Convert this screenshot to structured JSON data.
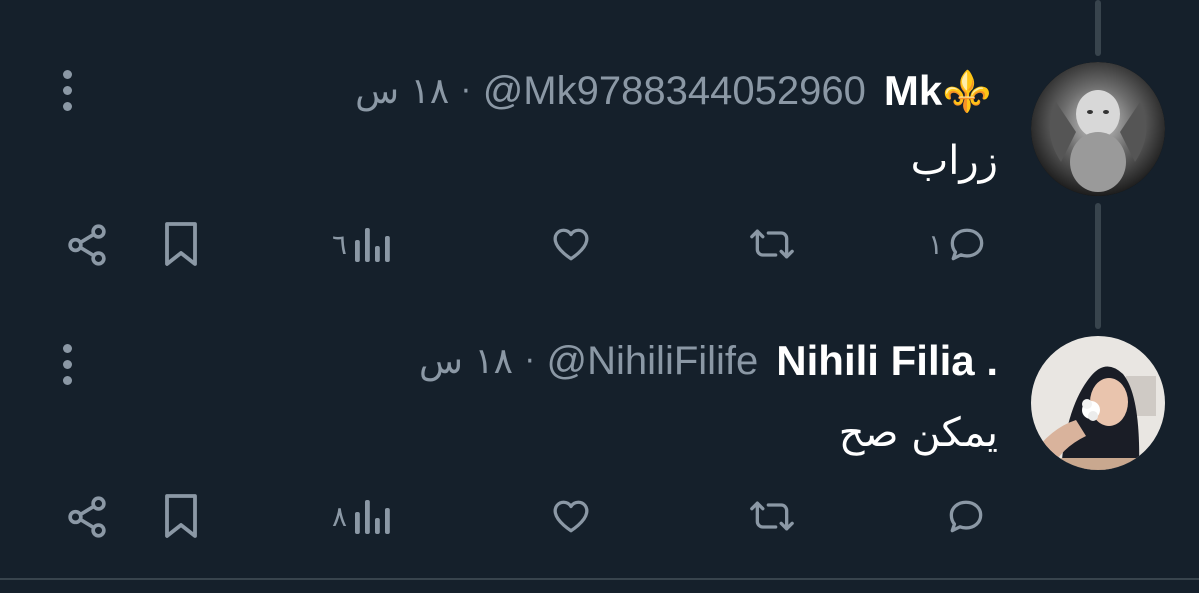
{
  "tweets": [
    {
      "display_name": "Mk",
      "emoji": "⚜️",
      "handle": "@Mk9788344052960",
      "separator": "·",
      "time": "١٨ س",
      "text": "زراب",
      "reply_count": "١",
      "view_count": "٦"
    },
    {
      "display_name": "Nihili Filia .",
      "handle": "@NihiliFilife",
      "separator": "·",
      "time": "١٨ س",
      "text": "يمكن صح",
      "reply_count": "",
      "view_count": "٨"
    }
  ],
  "colors": {
    "background": "#15202b",
    "secondary_text": "#8b98a5",
    "primary_text": "#ffffff",
    "thread_line": "#38444d"
  },
  "icons": [
    "more-icon",
    "reply-icon",
    "retweet-icon",
    "like-icon",
    "views-icon",
    "bookmark-icon",
    "share-icon"
  ]
}
